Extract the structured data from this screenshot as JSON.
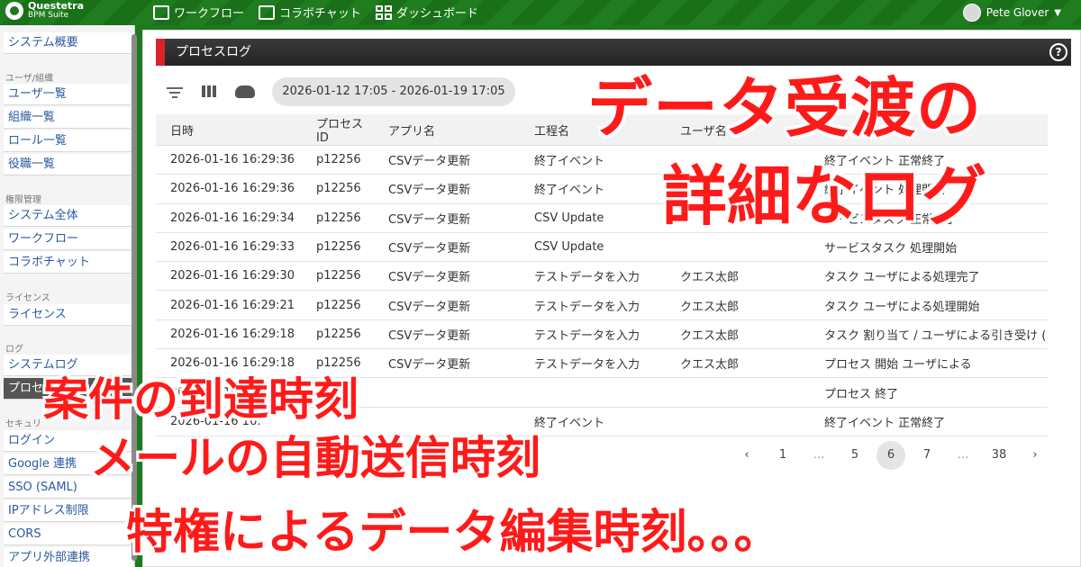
{
  "app": {
    "brand_line1": "Questetra",
    "brand_line2": "BPM Suite"
  },
  "nav": {
    "workflow": "ワークフロー",
    "chat": "コラボチャット",
    "dashboard": "ダッシュボード"
  },
  "user": {
    "name": "Pete Glover"
  },
  "sidebar": {
    "items": [
      {
        "label": "システム概要"
      },
      {
        "caption": "ユーザ/組織"
      },
      {
        "label": "ユーザ一覧"
      },
      {
        "label": "組織一覧"
      },
      {
        "label": "ロール一覧"
      },
      {
        "label": "役職一覧"
      },
      {
        "caption": "権限管理"
      },
      {
        "label": "システム全体"
      },
      {
        "label": "ワークフロー"
      },
      {
        "label": "コラボチャット"
      },
      {
        "caption": "ライセンス"
      },
      {
        "label": "ライセンス"
      },
      {
        "caption": "ログ"
      },
      {
        "label": "システムログ"
      },
      {
        "label": "プロセス"
      },
      {
        "caption": "セキュリ"
      },
      {
        "label": "ログイン"
      },
      {
        "label": "Google 連携"
      },
      {
        "label": "SSO (SAML)"
      },
      {
        "label": "IPアドレス制限"
      },
      {
        "label": "CORS"
      },
      {
        "label": "アプリ外部連携"
      }
    ]
  },
  "panel": {
    "title": "プロセスログ",
    "help": "?"
  },
  "filter": {
    "date_range": "2026-01-12 17:05 - 2026-01-19 17:05"
  },
  "table": {
    "headers": [
      "日時",
      "プロセスID",
      "アプリ名",
      "工程名",
      "ユーザ名",
      "操"
    ],
    "rows": [
      [
        "2026-01-16 16:29:36",
        "p12256",
        "CSVデータ更新",
        "終了イベント",
        "",
        "終了イベント 正常終了"
      ],
      [
        "2026-01-16 16:29:36",
        "p12256",
        "CSVデータ更新",
        "終了イベント",
        "",
        "終了イベント 処理開始"
      ],
      [
        "2026-01-16 16:29:34",
        "p12256",
        "CSVデータ更新",
        "CSV Update",
        "",
        "サービスタスク 正常終了"
      ],
      [
        "2026-01-16 16:29:33",
        "p12256",
        "CSVデータ更新",
        "CSV Update",
        "",
        "サービスタスク 処理開始"
      ],
      [
        "2026-01-16 16:29:30",
        "p12256",
        "CSVデータ更新",
        "テストデータを入力",
        "クエス太郎",
        "タスク ユーザによる処理完了"
      ],
      [
        "2026-01-16 16:29:21",
        "p12256",
        "CSVデータ更新",
        "テストデータを入力",
        "クエス太郎",
        "タスク ユーザによる処理開始"
      ],
      [
        "2026-01-16 16:29:18",
        "p12256",
        "CSVデータ更新",
        "テストデータを入力",
        "クエス太郎",
        "タスク 割り当て / ユーザによる引き受け ("
      ],
      [
        "2026-01-16 16:29:18",
        "p12256",
        "CSVデータ更新",
        "テストデータを入力",
        "クエス太郎",
        "プロセス 開始 ユーザによる"
      ],
      [
        "2026-01-16 16:",
        "",
        "",
        "",
        "",
        "プロセス 終了"
      ],
      [
        "2026-01-16 16:",
        "",
        "",
        "終了イベント",
        "",
        "終了イベント 正常終了"
      ]
    ]
  },
  "pagination": {
    "prev": "‹",
    "pages": [
      "1",
      "…",
      "5",
      "6",
      "7",
      "…",
      "38"
    ],
    "current": "6",
    "next": "›"
  },
  "overlay": {
    "line1": "データ受渡の",
    "line2": "詳細なログ",
    "line3": "案件の到達時刻",
    "line4": "メールの自動送信時刻",
    "line5": "特権によるデータ編集時刻。。。"
  },
  "colors": {
    "brand_green": "#1f7a1f",
    "accent_red": "#d9232b",
    "overlay_red": "#ff1a1a"
  }
}
